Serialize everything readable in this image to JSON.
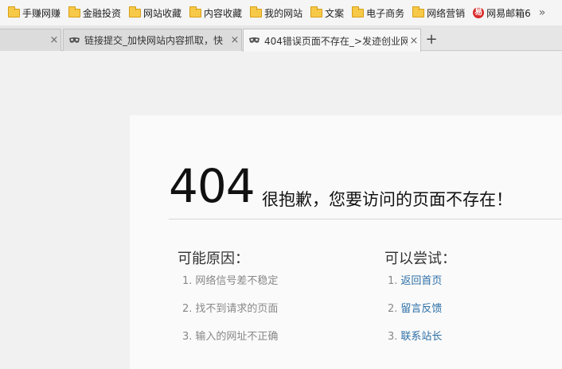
{
  "bookmarks": {
    "items": [
      {
        "label": "手赚网赚",
        "icon": "folder-icon"
      },
      {
        "label": "金融投资",
        "icon": "folder-icon"
      },
      {
        "label": "网站收藏",
        "icon": "folder-icon"
      },
      {
        "label": "内容收藏",
        "icon": "folder-icon"
      },
      {
        "label": "我的网站",
        "icon": "folder-icon"
      },
      {
        "label": "文案",
        "icon": "folder-icon"
      },
      {
        "label": "电子商务",
        "icon": "folder-icon"
      },
      {
        "label": "网络营销",
        "icon": "folder-icon"
      },
      {
        "label": "网易邮箱6",
        "icon": "netease-mail-icon",
        "glyph": "易"
      }
    ],
    "more": "»"
  },
  "tabs": [
    {
      "title": "",
      "close": "×",
      "active": false
    },
    {
      "title": "链接提交_加快网站内容抓取，快",
      "close": "×",
      "active": false,
      "icon": "mask-favicon-icon"
    },
    {
      "title": "404错误页面不存在_>发迹创业网",
      "close": "×",
      "active": true,
      "icon": "mask-favicon-icon"
    }
  ],
  "new_tab": "+",
  "error_page": {
    "code": "404",
    "message": "很抱歉，您要访问的页面不存在！",
    "reasons_title": "可能原因：",
    "reasons": [
      {
        "num": "1.",
        "text": "网络信号差不稳定"
      },
      {
        "num": "2.",
        "text": "找不到请求的页面"
      },
      {
        "num": "3.",
        "text": "输入的网址不正确"
      }
    ],
    "tries_title": "可以尝试：",
    "tries": [
      {
        "num": "1.",
        "text": "返回首页"
      },
      {
        "num": "2.",
        "text": "留言反馈"
      },
      {
        "num": "3.",
        "text": "联系站长"
      }
    ]
  },
  "colors": {
    "link": "#2d6fa6",
    "folder": "#f7c948",
    "muted": "#888888"
  }
}
